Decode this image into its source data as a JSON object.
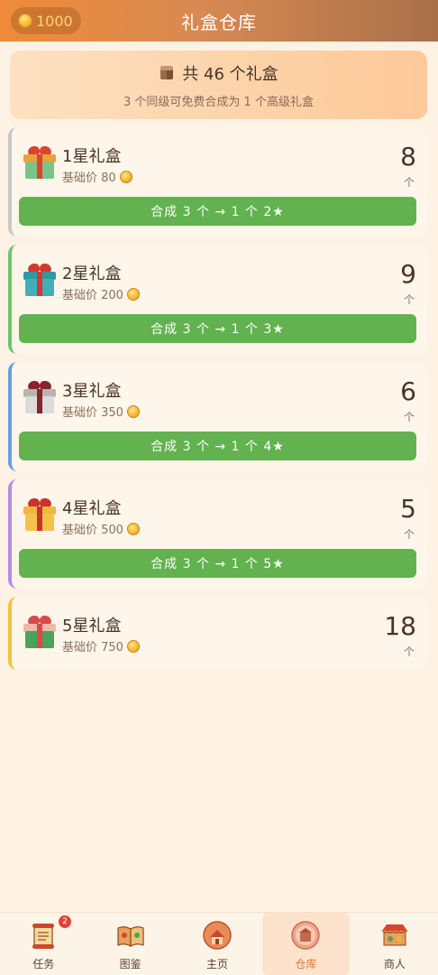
{
  "header": {
    "coins": "1000",
    "title": "礼盒仓库"
  },
  "summary": {
    "total_text": "共 46 个礼盒",
    "hint": "3 个同级可免费合成为 1 个高级礼盒"
  },
  "boxes": [
    {
      "name": "1星礼盒",
      "price_label": "基础价 80",
      "count": "8",
      "unit": "个",
      "merge_label": "合成 3 个 → 1 个 2★",
      "stripe_color": "#c8c8c8",
      "lid_color": "#e9a23a",
      "body_color": "#7cc38a",
      "ribbon_color": "#d9452f"
    },
    {
      "name": "2星礼盒",
      "price_label": "基础价 200",
      "count": "9",
      "unit": "个",
      "merge_label": "合成 3 个 → 1 个 3★",
      "stripe_color": "#6dc46a",
      "lid_color": "#2d9aa0",
      "body_color": "#3fb0b5",
      "ribbon_color": "#d23a2f"
    },
    {
      "name": "3星礼盒",
      "price_label": "基础价 350",
      "count": "6",
      "unit": "个",
      "merge_label": "合成 3 个 → 1 个 4★",
      "stripe_color": "#6a9ee0",
      "lid_color": "#b9b4b2",
      "body_color": "#dedad8",
      "ribbon_color": "#8a2330"
    },
    {
      "name": "4星礼盒",
      "price_label": "基础价 500",
      "count": "5",
      "unit": "个",
      "merge_label": "合成 3 个 → 1 个 5★",
      "stripe_color": "#b98be8",
      "lid_color": "#f0b640",
      "body_color": "#f4c24c",
      "ribbon_color": "#c8332b"
    },
    {
      "name": "5星礼盒",
      "price_label": "基础价 750",
      "count": "18",
      "unit": "个",
      "stripe_color": "#f1c43a",
      "lid_color": "#f0b8a8",
      "body_color": "#4aa35a",
      "ribbon_color": "#d94a4a"
    }
  ],
  "nav": {
    "items": [
      {
        "label": "任务",
        "badge": "2"
      },
      {
        "label": "图鉴"
      },
      {
        "label": "主页"
      },
      {
        "label": "仓库"
      },
      {
        "label": "商人"
      }
    ]
  }
}
